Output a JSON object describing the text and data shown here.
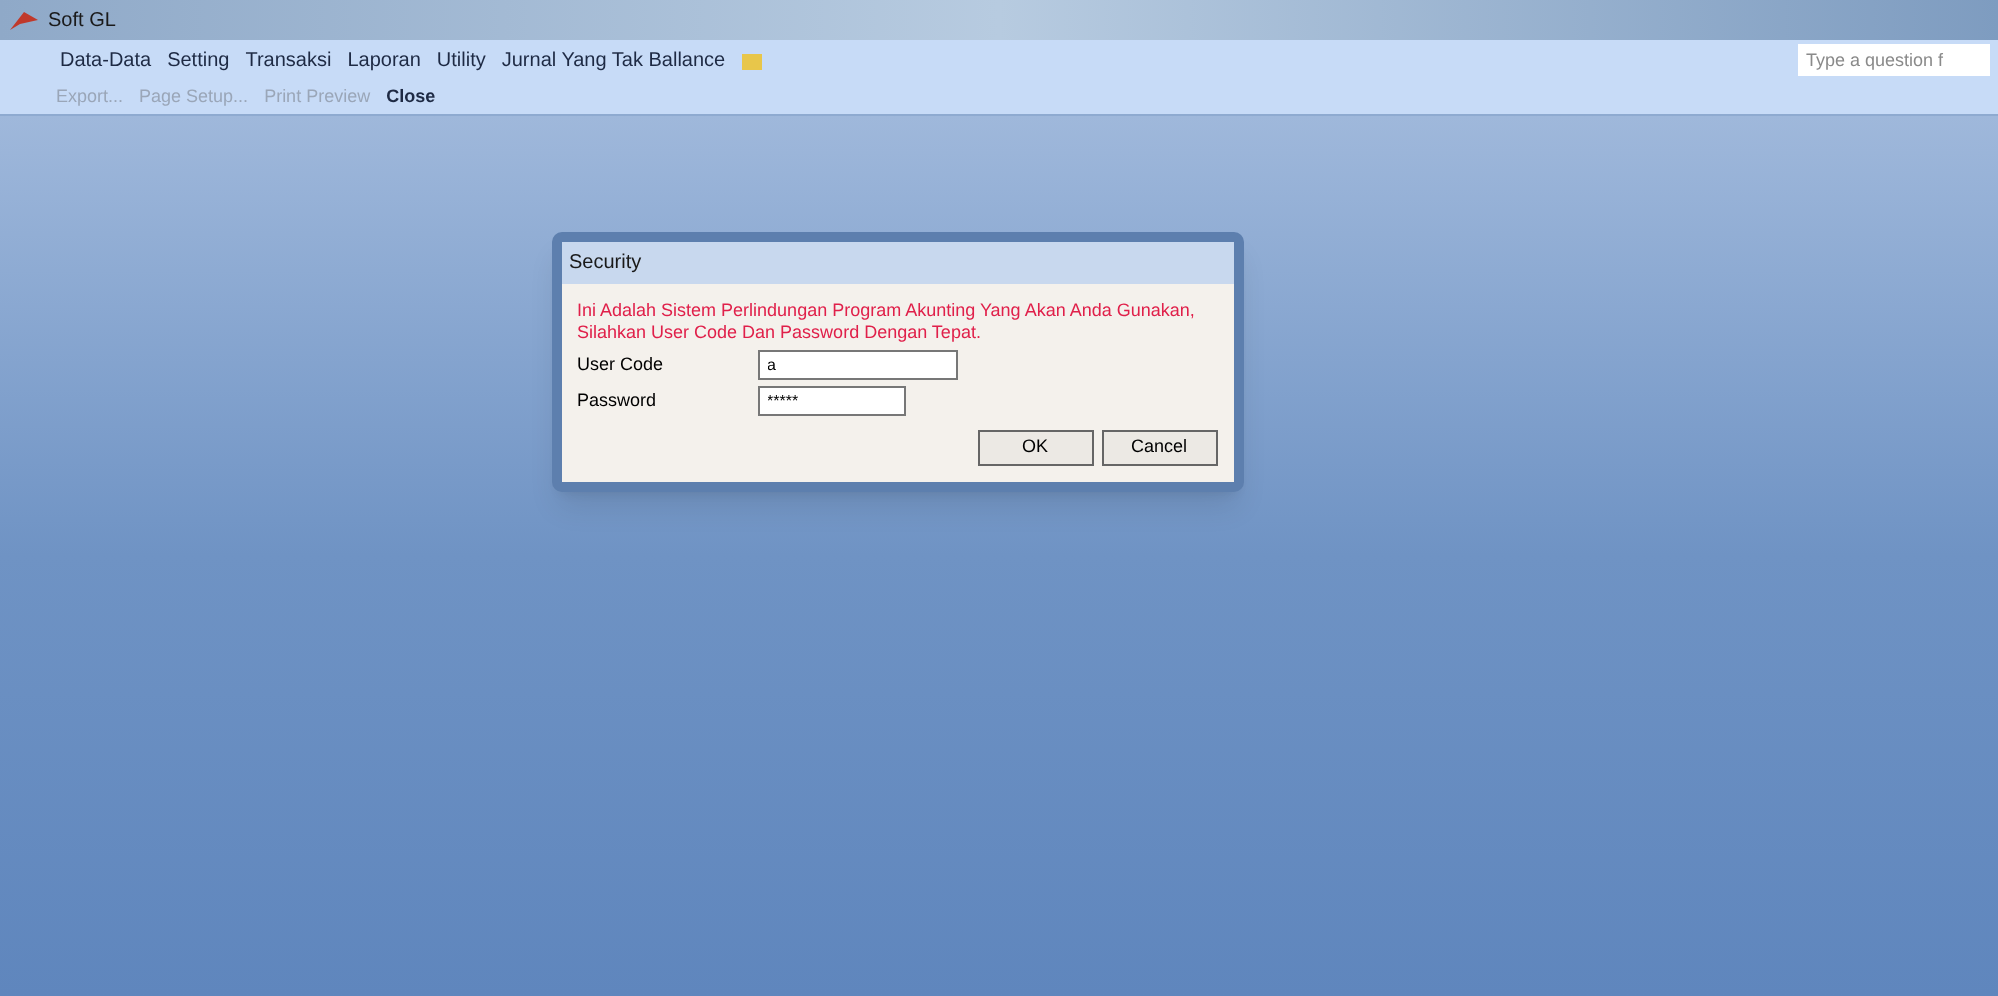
{
  "window": {
    "title": "Soft GL"
  },
  "menu": [
    "Data-Data",
    "Setting",
    "Transaksi",
    "Laporan",
    "Utility",
    "Jurnal Yang Tak Ballance"
  ],
  "help_search": {
    "placeholder": "Type a question f"
  },
  "toolbar": [
    {
      "label": "Export...",
      "disabled": true
    },
    {
      "label": "Page Setup...",
      "disabled": true
    },
    {
      "label": "Print Preview",
      "disabled": true
    },
    {
      "label": "Close",
      "disabled": false
    }
  ],
  "dialog": {
    "title": "Security",
    "message": "Ini Adalah Sistem Perlindungan Program Akunting Yang Akan Anda Gunakan, Silahkan User Code Dan Password Dengan Tepat.",
    "fields": [
      {
        "label": "User Code",
        "value": "a"
      },
      {
        "label": "Password",
        "value": "*****"
      }
    ],
    "buttons": [
      "OK",
      "Cancel"
    ]
  }
}
